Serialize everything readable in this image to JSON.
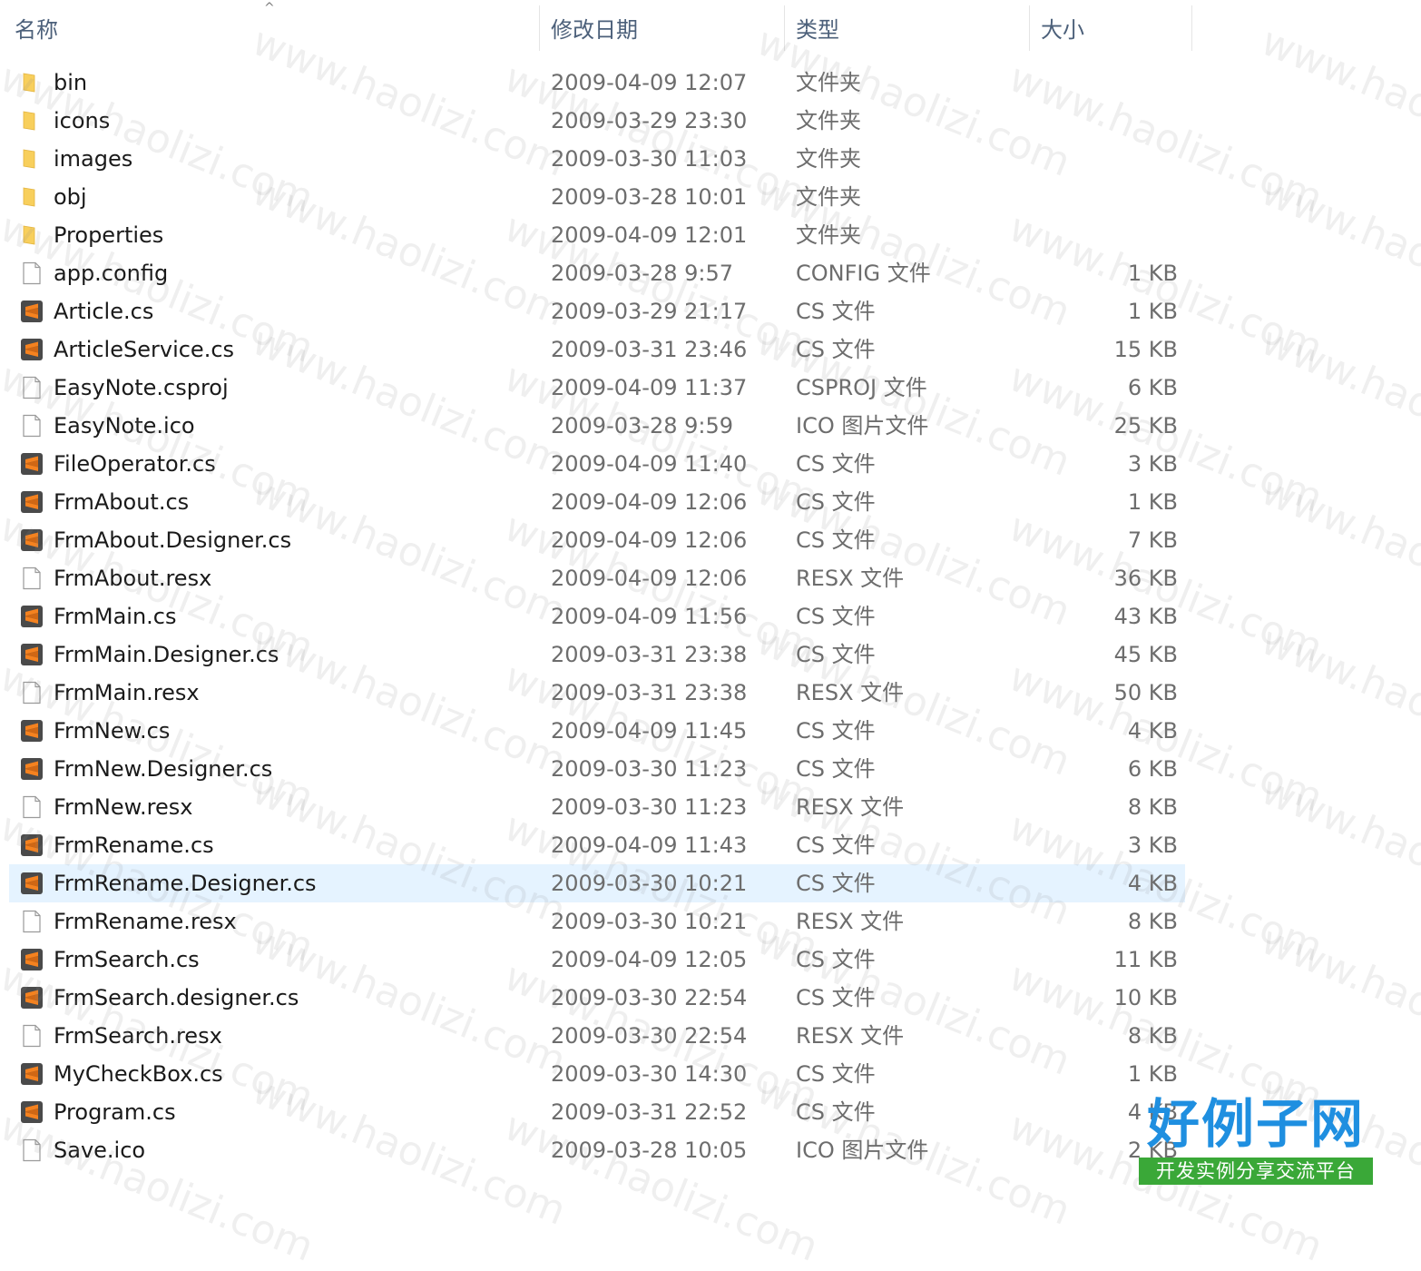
{
  "columns": {
    "name": "名称",
    "date": "修改日期",
    "type": "类型",
    "size": "大小"
  },
  "files": [
    {
      "name": "bin",
      "date": "2009-04-09 12:07",
      "type": "文件夹",
      "size": "",
      "icon": "folder-icon"
    },
    {
      "name": "icons",
      "date": "2009-03-29 23:30",
      "type": "文件夹",
      "size": "",
      "icon": "folder-icon"
    },
    {
      "name": "images",
      "date": "2009-03-30 11:03",
      "type": "文件夹",
      "size": "",
      "icon": "folder-icon"
    },
    {
      "name": "obj",
      "date": "2009-03-28 10:01",
      "type": "文件夹",
      "size": "",
      "icon": "folder-icon"
    },
    {
      "name": "Properties",
      "date": "2009-04-09 12:01",
      "type": "文件夹",
      "size": "",
      "icon": "folder-icon"
    },
    {
      "name": "app.config",
      "date": "2009-03-28 9:57",
      "type": "CONFIG 文件",
      "size": "1 KB",
      "icon": "file-icon"
    },
    {
      "name": "Article.cs",
      "date": "2009-03-29 21:17",
      "type": "CS 文件",
      "size": "1 KB",
      "icon": "sublime-icon"
    },
    {
      "name": "ArticleService.cs",
      "date": "2009-03-31 23:46",
      "type": "CS 文件",
      "size": "15 KB",
      "icon": "sublime-icon"
    },
    {
      "name": "EasyNote.csproj",
      "date": "2009-04-09 11:37",
      "type": "CSPROJ 文件",
      "size": "6 KB",
      "icon": "file-icon"
    },
    {
      "name": "EasyNote.ico",
      "date": "2009-03-28 9:59",
      "type": "ICO 图片文件",
      "size": "25 KB",
      "icon": "file-icon"
    },
    {
      "name": "FileOperator.cs",
      "date": "2009-04-09 11:40",
      "type": "CS 文件",
      "size": "3 KB",
      "icon": "sublime-icon"
    },
    {
      "name": "FrmAbout.cs",
      "date": "2009-04-09 12:06",
      "type": "CS 文件",
      "size": "1 KB",
      "icon": "sublime-icon"
    },
    {
      "name": "FrmAbout.Designer.cs",
      "date": "2009-04-09 12:06",
      "type": "CS 文件",
      "size": "7 KB",
      "icon": "sublime-icon"
    },
    {
      "name": "FrmAbout.resx",
      "date": "2009-04-09 12:06",
      "type": "RESX 文件",
      "size": "36 KB",
      "icon": "file-icon"
    },
    {
      "name": "FrmMain.cs",
      "date": "2009-04-09 11:56",
      "type": "CS 文件",
      "size": "43 KB",
      "icon": "sublime-icon"
    },
    {
      "name": "FrmMain.Designer.cs",
      "date": "2009-03-31 23:38",
      "type": "CS 文件",
      "size": "45 KB",
      "icon": "sublime-icon"
    },
    {
      "name": "FrmMain.resx",
      "date": "2009-03-31 23:38",
      "type": "RESX 文件",
      "size": "50 KB",
      "icon": "file-icon"
    },
    {
      "name": "FrmNew.cs",
      "date": "2009-04-09 11:45",
      "type": "CS 文件",
      "size": "4 KB",
      "icon": "sublime-icon"
    },
    {
      "name": "FrmNew.Designer.cs",
      "date": "2009-03-30 11:23",
      "type": "CS 文件",
      "size": "6 KB",
      "icon": "sublime-icon"
    },
    {
      "name": "FrmNew.resx",
      "date": "2009-03-30 11:23",
      "type": "RESX 文件",
      "size": "8 KB",
      "icon": "file-icon"
    },
    {
      "name": "FrmRename.cs",
      "date": "2009-04-09 11:43",
      "type": "CS 文件",
      "size": "3 KB",
      "icon": "sublime-icon"
    },
    {
      "name": "FrmRename.Designer.cs",
      "date": "2009-03-30 10:21",
      "type": "CS 文件",
      "size": "4 KB",
      "icon": "sublime-icon",
      "selected": true
    },
    {
      "name": "FrmRename.resx",
      "date": "2009-03-30 10:21",
      "type": "RESX 文件",
      "size": "8 KB",
      "icon": "file-icon"
    },
    {
      "name": "FrmSearch.cs",
      "date": "2009-04-09 12:05",
      "type": "CS 文件",
      "size": "11 KB",
      "icon": "sublime-icon"
    },
    {
      "name": "FrmSearch.designer.cs",
      "date": "2009-03-30 22:54",
      "type": "CS 文件",
      "size": "10 KB",
      "icon": "sublime-icon"
    },
    {
      "name": "FrmSearch.resx",
      "date": "2009-03-30 22:54",
      "type": "RESX 文件",
      "size": "8 KB",
      "icon": "file-icon"
    },
    {
      "name": "MyCheckBox.cs",
      "date": "2009-03-30 14:30",
      "type": "CS 文件",
      "size": "1 KB",
      "icon": "sublime-icon"
    },
    {
      "name": "Program.cs",
      "date": "2009-03-31 22:52",
      "type": "CS 文件",
      "size": "4 KB",
      "icon": "sublime-icon"
    },
    {
      "name": "Save.ico",
      "date": "2009-03-28 10:05",
      "type": "ICO 图片文件",
      "size": "2 KB",
      "icon": "file-icon"
    }
  ],
  "watermark": "www.haolizi.com",
  "logo": {
    "main": "好例子网",
    "sub": "开发实例分享交流平台"
  },
  "colors": {
    "header_text": "#4c607a",
    "selected_row": "#e5f3ff",
    "folder": "#f8cf5c",
    "sublime_icon": "#f5821f",
    "logo_blue": "#1f8fe0",
    "logo_green": "#3aa838"
  }
}
